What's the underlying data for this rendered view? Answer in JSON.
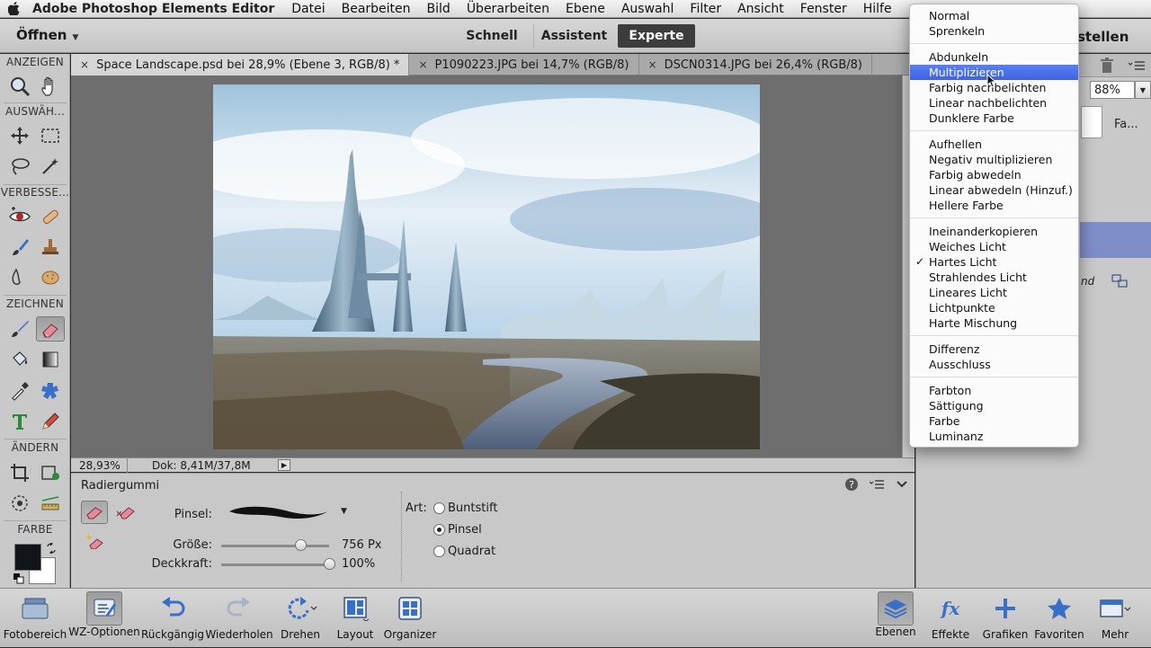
{
  "menubar": {
    "app_name": "Adobe Photoshop Elements Editor",
    "items": [
      "Datei",
      "Bearbeiten",
      "Bild",
      "Überarbeiten",
      "Ebene",
      "Auswahl",
      "Filter",
      "Ansicht",
      "Fenster",
      "Hilfe"
    ]
  },
  "appbar": {
    "open_label": "Öffnen",
    "modes": [
      "Schnell",
      "Assistent",
      "Experte"
    ],
    "active_mode": "Experte",
    "create_label": "stellen"
  },
  "toolbox": {
    "sections": [
      "ANZEIGEN",
      "AUSWÄH...",
      "VERBESSE...",
      "ZEICHNEN",
      "ÄNDERN",
      "FARBE"
    ],
    "tools": [
      "zoom-tool-icon",
      "hand-tool-icon",
      "move-tool-icon",
      "marquee-tool-icon",
      "lasso-tool-icon",
      "magic-wand-tool-icon",
      "red-eye-tool-icon",
      "healing-brush-tool-icon",
      "smart-brush-tool-icon",
      "clone-stamp-tool-icon",
      "blur-tool-icon",
      "sponge-tool-icon",
      "brush-tool-icon",
      "eraser-tool-icon",
      "paint-bucket-tool-icon",
      "gradient-tool-icon",
      "eyedropper-tool-icon",
      "custom-shape-tool-icon",
      "type-tool-icon",
      "pencil-tool-icon",
      "crop-tool-icon",
      "recompose-tool-icon",
      "content-aware-move-tool-icon",
      "straighten-tool-icon"
    ],
    "active_tool": "eraser-tool-icon",
    "foreground_color": "#111418",
    "background_color": "#ffffff"
  },
  "tabs": [
    {
      "label": "Space Landscape.psd bei 28,9% (Ebene 3, RGB/8) *",
      "close": "×",
      "active": true
    },
    {
      "label": "P1090223.JPG bei 14,7% (RGB/8)",
      "close": "×",
      "active": false
    },
    {
      "label": "DSCN0314.JPG bei 26,4% (RGB/8)",
      "close": "×",
      "active": false
    }
  ],
  "status": {
    "zoom": "28,93%",
    "doc": "Dok: 8,41M/37,8M"
  },
  "tool_options": {
    "title": "Radiergummi",
    "brush_label": "Pinsel:",
    "size_label": "Größe:",
    "size_value": "756 Px",
    "size_fraction": 0.74,
    "opacity_label": "Deckkraft:",
    "opacity_value": "100%",
    "opacity_fraction": 1.0,
    "type_label": "Art:",
    "types": [
      {
        "label": "Buntstift",
        "selected": false
      },
      {
        "label": "Pinsel",
        "selected": true
      },
      {
        "label": "Quadrat",
        "selected": false
      }
    ]
  },
  "right_panel": {
    "opacity_value": "88%",
    "fa_label": "Fa...",
    "nd_label": "nd"
  },
  "blend_menu": {
    "groups": [
      [
        "Normal",
        "Sprenkeln"
      ],
      [
        "Abdunkeln",
        "Multiplizieren",
        "Farbig nachbelichten",
        "Linear nachbelichten",
        "Dunklere Farbe"
      ],
      [
        "Aufhellen",
        "Negativ multiplizieren",
        "Farbig abwedeln",
        "Linear abwedeln (Hinzuf.)",
        "Hellere Farbe"
      ],
      [
        "Ineinanderkopieren",
        "Weiches Licht",
        "Hartes Licht",
        "Strahlendes Licht",
        "Lineares Licht",
        "Lichtpunkte",
        "Harte Mischung"
      ],
      [
        "Differenz",
        "Ausschluss"
      ],
      [
        "Farbton",
        "Sättigung",
        "Farbe",
        "Luminanz"
      ]
    ],
    "highlighted": "Multiplizieren",
    "checked": "Hartes Licht",
    "check_mark": "✓"
  },
  "bottombar": {
    "left": [
      {
        "label": "Fotobereich",
        "icon": "photo-bin-icon"
      },
      {
        "label": "WZ-Optionen",
        "icon": "tool-options-icon",
        "selected": true
      },
      {
        "label": "Rückgängig",
        "icon": "undo-icon"
      },
      {
        "label": "Wiederholen",
        "icon": "redo-icon"
      },
      {
        "label": "Drehen",
        "icon": "rotate-icon"
      },
      {
        "label": "Layout",
        "icon": "layout-icon"
      },
      {
        "label": "Organizer",
        "icon": "organizer-icon"
      }
    ],
    "right": [
      {
        "label": "Ebenen",
        "icon": "layers-icon",
        "selected": true
      },
      {
        "label": "Effekte",
        "icon": "effects-icon"
      },
      {
        "label": "Grafiken",
        "icon": "graphics-icon"
      },
      {
        "label": "Favoriten",
        "icon": "favorites-icon"
      },
      {
        "label": "Mehr",
        "icon": "more-icon"
      }
    ]
  },
  "colors": {
    "menu_highlight": "#3d63e6",
    "experte_bg": "#3c3c3c",
    "layer_selected": "#7e8ec9"
  }
}
